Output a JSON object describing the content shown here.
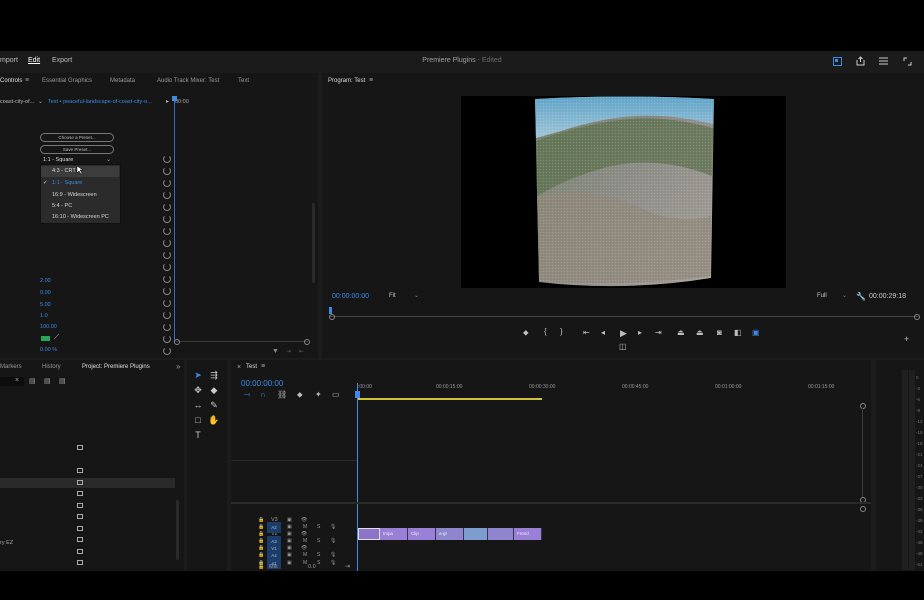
{
  "menu": {
    "import": "mport",
    "edit": "Edit",
    "export": "Export"
  },
  "title": {
    "name": "Premiere Plugins",
    "edited": " - Edited"
  },
  "controls_panel": {
    "tabs": [
      "Controls",
      "Essential Graphics",
      "Metadata",
      "Audio Track Mixer: Test",
      "Text"
    ],
    "source": "coast-city-of...",
    "sequence": "Test • peaceful-landscape-of-coast-city-o...",
    "timecode": "00:00",
    "choose_preset": "Choose a Preset...",
    "save_preset": "Save Preset...",
    "aspect_select": "1:1 - Square",
    "dropdown_items": [
      "4:3 - CRT",
      "1:1 - Square",
      "16:9 - Widescreen",
      "5:4 - PC",
      "16:10 - Widescreen PC"
    ],
    "dropdown_selected_index": 1,
    "dropdown_hover_index": 0,
    "values": [
      "2.00",
      "0.00",
      "5.00",
      "1.0",
      "100.00",
      "",
      "0.00 %"
    ]
  },
  "program": {
    "title": "Program: Test",
    "timecode": "00:00:00:00",
    "fit": "Fit",
    "quality": "Full",
    "duration": "00:00:29:18"
  },
  "project_panel": {
    "tabs": [
      "Markers",
      "History",
      "Project: Premiere Plugins"
    ],
    "partial_item": "ry EZ"
  },
  "timeline": {
    "tab": "Test",
    "timecode": "00:00:00:00",
    "ruler": [
      ":00:00",
      "00:00:15:00",
      "00:00:30:00",
      "00:00:45:00",
      "00:01:00:00",
      "00:01:15:00"
    ],
    "video_tracks": [
      "V3",
      "V2",
      "V1"
    ],
    "audio_tracks": [
      "A1",
      "A2",
      "A3",
      "A4"
    ],
    "mix": "Mix",
    "mix_value": "0.0",
    "clips": [
      "",
      "Impa",
      "Clip",
      "a-gr",
      "",
      "",
      "Frend"
    ]
  },
  "meter": {
    "ticks": [
      "0",
      "-3",
      "-6",
      "-9",
      "-12",
      "-15",
      "-18",
      "-21",
      "-24",
      "-27",
      "-30",
      "-33",
      "-36",
      "-39",
      "-42",
      "-45",
      "-48",
      "-51",
      "-54"
    ]
  },
  "colors": {
    "accent": "#3d8ae8",
    "clip": "#9a7fd6",
    "panel": "#161616"
  }
}
